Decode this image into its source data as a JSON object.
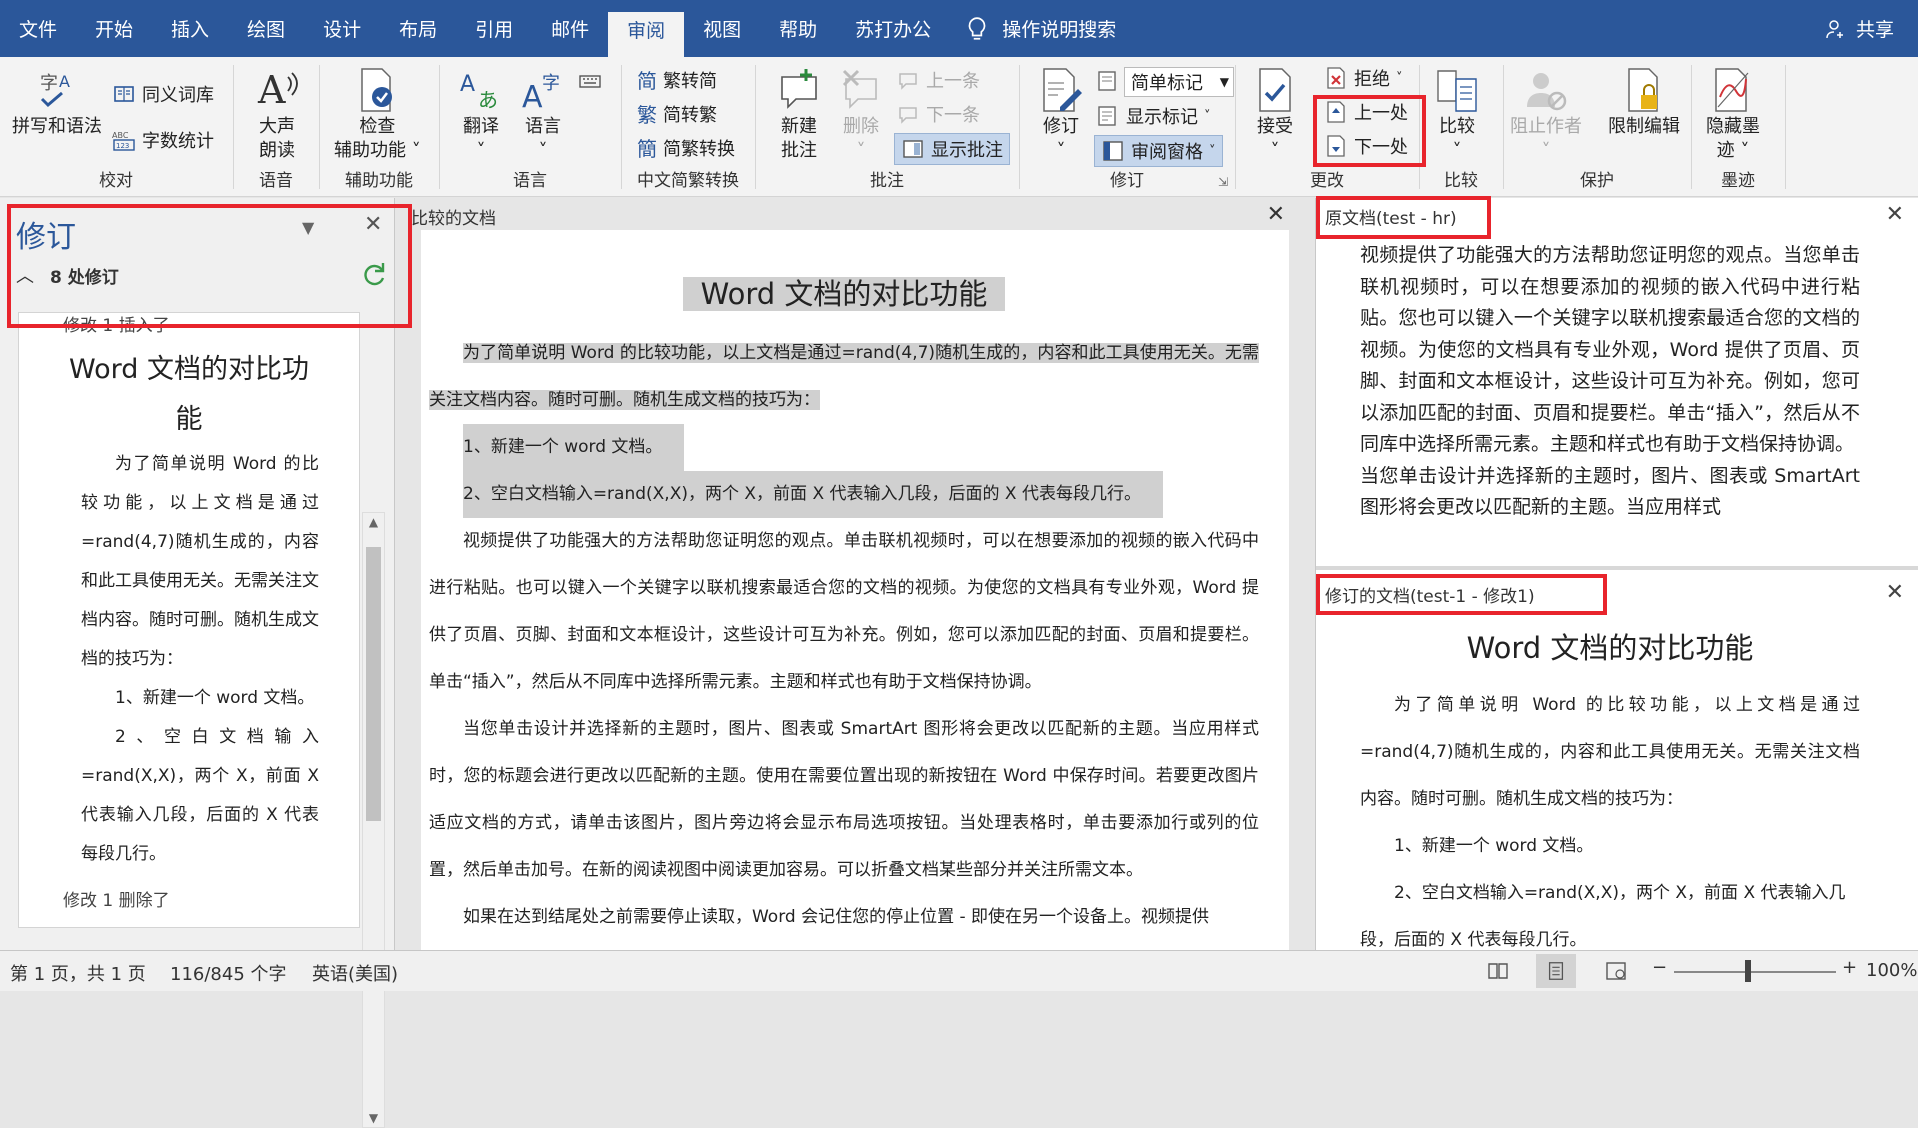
{
  "menu": {
    "tabs": [
      "文件",
      "开始",
      "插入",
      "绘图",
      "设计",
      "布局",
      "引用",
      "邮件",
      "审阅",
      "视图",
      "帮助",
      "苏打办公"
    ],
    "active_tab": "审阅",
    "search_label": "操作说明搜索",
    "share_label": "共享"
  },
  "ribbon": {
    "proofing": {
      "spell": "拼写和语法",
      "thesaurus": "同义词库",
      "wordcount": "字数统计",
      "title": "校对"
    },
    "speech": {
      "read_aloud_line1": "大声",
      "read_aloud_line2": "朗读",
      "title": "语音"
    },
    "accessibility": {
      "check_line1": "检查",
      "check_line2": "辅助功能",
      "title": "辅助功能"
    },
    "language": {
      "translate": "翻译",
      "language": "语言",
      "title": "语言"
    },
    "chinese": {
      "to_trad": "繁转简",
      "to_simp": "简转繁",
      "convert": "简繁转换",
      "title": "中文简繁转换"
    },
    "comments": {
      "new_line1": "新建",
      "new_line2": "批注",
      "delete": "删除",
      "prev": "上一条",
      "next": "下一条",
      "show": "显示批注",
      "title": "批注"
    },
    "tracking": {
      "track": "修订",
      "markup_select": "简单标记",
      "show_markup": "显示标记",
      "review_pane": "审阅窗格",
      "title": "修订"
    },
    "changes": {
      "accept": "接受",
      "reject": "拒绝",
      "previous": "上一处",
      "next": "下一处",
      "title": "更改"
    },
    "compare": {
      "compare": "比较",
      "title": "比较"
    },
    "protect": {
      "block_authors": "阻止作者",
      "restrict": "限制编辑",
      "title": "保护"
    },
    "ink": {
      "hide_line1": "隐藏墨",
      "hide_line2": "迹",
      "title": "墨迹"
    }
  },
  "revisions_pane": {
    "title": "修订",
    "count": "8 处修订",
    "item1_label": "修改 1 插入了",
    "item1_heading": "Word 文档的对比功能",
    "item1_para": "为了简单说明 Word 的比较功能，以上文档是通过=rand(4,7)随机生成的，内容和此工具使用无关。无需关注文档内容。随时可删。随机生成文档的技巧为：",
    "item1_list1": "1、新建一个 word 文档。",
    "item1_list2": "2、空白文档输入=rand(X,X)，两个 X，前面 X 代表输入几段，后面的 X 代表每段几行。",
    "item2_label": "修改 1 删除了"
  },
  "compared_doc": {
    "title": "比较的文档",
    "heading": "Word 文档的对比功能",
    "intro": "为了简单说明 Word 的比较功能，以上文档是通过=rand(4,7)随机生成的，内容和此工具使用无关。无需关注文档内容。随时可删。随机生成文档的技巧为：",
    "list1": "1、新建一个 word 文档。",
    "list2": "2、空白文档输入=rand(X,X)，两个 X，前面 X 代表输入几段，后面的 X 代表每段几行。",
    "para1": "视频提供了功能强大的方法帮助您证明您的观点。单击联机视频时，可以在想要添加的视频的嵌入代码中进行粘贴。也可以键入一个关键字以联机搜索最适合您的文档的视频。为使您的文档具有专业外观，Word 提供了页眉、页脚、封面和文本框设计，这些设计可互为补充。例如，您可以添加匹配的封面、页眉和提要栏。单击“插入”，然后从不同库中选择所需元素。主题和样式也有助于文档保持协调。",
    "para2": "当您单击设计并选择新的主题时，图片、图表或 SmartArt 图形将会更改以匹配新的主题。当应用样式时，您的标题会进行更改以匹配新的主题。使用在需要位置出现的新按钮在 Word 中保存时间。若要更改图片适应文档的方式，请单击该图片，图片旁边将会显示布局选项按钮。当处理表格时，单击要添加行或列的位置，然后单击加号。在新的阅读视图中阅读更加容易。可以折叠文档某些部分并关注所需文本。",
    "para3": "如果在达到结尾处之前需要停止读取，Word 会记住您的停止位置 - 即使在另一个设备上。视频提供"
  },
  "original_doc": {
    "title": "原文档(test - hr)",
    "para1": "视频提供了功能强大的方法帮助您证明您的观点。当您单击联机视频时，可以在想要添加的视频的嵌入代码中进行粘贴。您也可以键入一个关键字以联机搜索最适合您的文档的视频。为使您的文档具有专业外观，Word 提供了页眉、页脚、封面和文本框设计，这些设计可互为补充。例如，您可以添加匹配的封面、页眉和提要栏。单击“插入”，然后从不同库中选择所需元素。主题和样式也有助于文档保持协调。",
    "para2": "当您单击设计并选择新的主题时，图片、图表或 SmartArt 图形将会更改以匹配新的主题。当应用样式"
  },
  "revised_doc": {
    "title": "修订的文档(test-1 - 修改1)",
    "heading": "Word 文档的对比功能",
    "para": "为了简单说明 Word 的比较功能，以上文档是通过=rand(4,7)随机生成的，内容和此工具使用无关。无需关注文档内容。随时可删。随机生成文档的技巧为：",
    "list1": "1、新建一个 word 文档。",
    "list2": "2、空白文档输入=rand(X,X)，两个 X，前面 X 代表输入几段，后面的 X 代表每段几行。"
  },
  "status": {
    "page": "第 1 页，共 1 页",
    "words": "116/845 个字",
    "language": "英语(美国)",
    "zoom": "100%",
    "zoom_minus": "−",
    "zoom_plus": "+"
  },
  "colors": {
    "title_bar": "#2b579a",
    "highlight": "#e8242c",
    "deleted_gray": "#d0d0d0"
  }
}
